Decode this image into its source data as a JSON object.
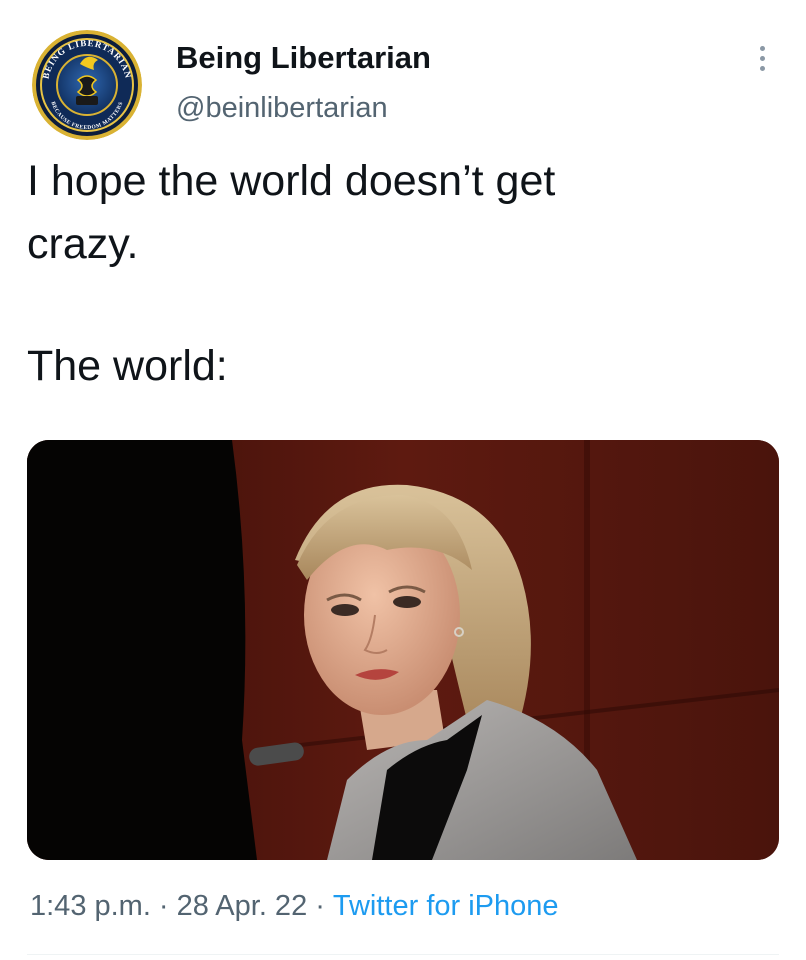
{
  "tweet": {
    "author": {
      "name": "Being Libertarian",
      "handle": "@beinlibertarian",
      "avatar_text_top": "BEING LIBERTARIAN",
      "avatar_text_bottom": "BECAUSE FREEDOM MATTERS"
    },
    "text_lines": [
      "I hope the world doesn’t get",
      "crazy."
    ],
    "text_line_2": "The world:",
    "media_icon": "photo-of-woman-in-courtroom",
    "meta": {
      "time": "1:43 p.m.",
      "separator": "·",
      "date": "28 Apr. 22",
      "source": "Twitter for iPhone"
    }
  },
  "colors": {
    "link": "#1d9bf0",
    "secondary_text": "#536471",
    "primary_text": "#0f1419"
  }
}
